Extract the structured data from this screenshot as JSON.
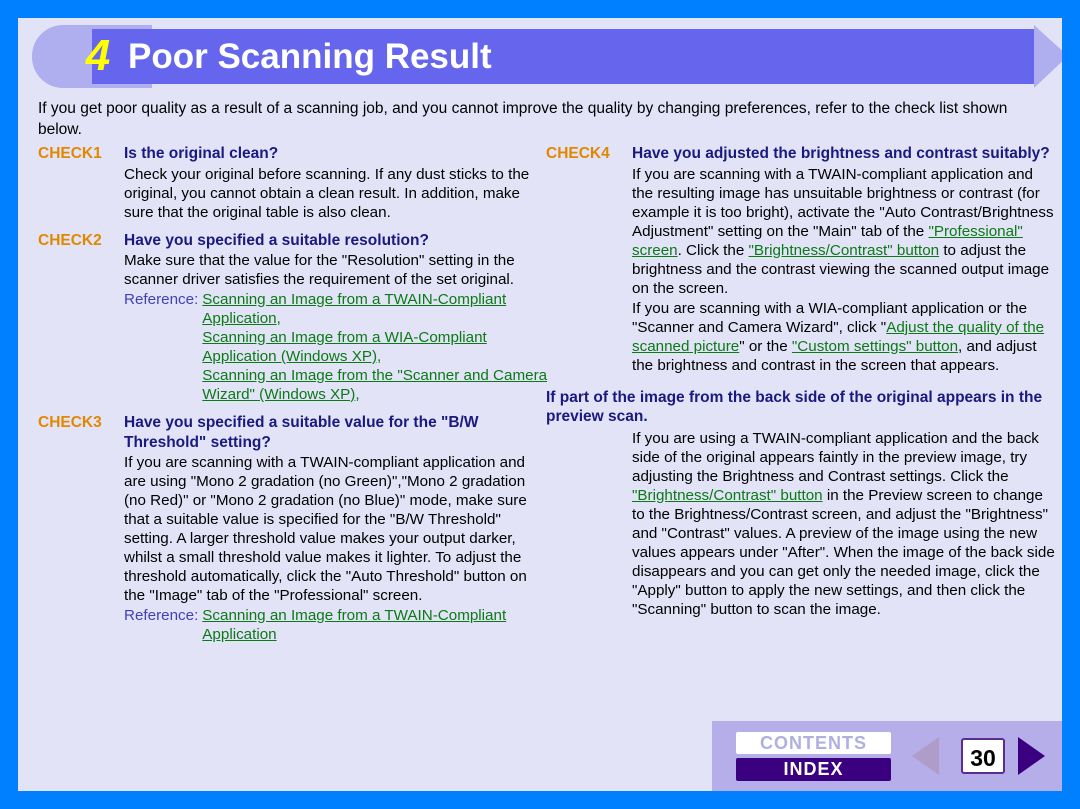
{
  "header": {
    "number": "4",
    "title": "Poor Scanning Result"
  },
  "intro": "If you get poor quality as a result of a scanning job, and you cannot improve the quality by changing preferences, refer to the check list shown below.",
  "reference_label": "Reference:",
  "checks": {
    "check1": {
      "label": "CHECK1",
      "title": "Is the original clean?",
      "body": "Check your original before scanning. If any dust sticks to the original, you cannot obtain a clean result. In addition, make sure that the original table is also clean."
    },
    "check2": {
      "label": "CHECK2",
      "title": "Have you specified a suitable resolution?",
      "body": "Make sure that the value for the \"Resolution\" setting in the scanner driver satisfies the requirement of the set original.",
      "links": [
        "Scanning an Image from a TWAIN-Compliant Application",
        "Scanning an Image from a WIA-Compliant Application (Windows XP)",
        "Scanning an Image from the \"Scanner and Camera Wizard\" (Windows XP)"
      ]
    },
    "check3": {
      "label": "CHECK3",
      "title": "Have you specified a suitable value for the \"B/W Threshold\" setting?",
      "body": "If you are scanning with a TWAIN-compliant application and are using \"Mono 2 gradation (no Green)\",\"Mono 2 gradation (no Red)\" or \"Mono 2 gradation (no Blue)\" mode, make sure that a suitable value is specified for the \"B/W Threshold\" setting. A larger threshold value makes your output darker, whilst a small threshold value makes it lighter. To adjust the threshold automatically, click the \"Auto Threshold\" button on the \"Image\" tab of the \"Professional\" screen.",
      "links": [
        "Scanning an Image from a TWAIN-Compliant Application"
      ]
    },
    "check4": {
      "label": "CHECK4",
      "title": "Have you adjusted the brightness and contrast suitably?",
      "body_p1_a": "If you are scanning with a TWAIN-compliant application and the resulting image has unsuitable brightness or contrast (for example it is too bright), activate the \"Auto Contrast/Brightness Adjustment\" setting on the \"Main\" tab of the ",
      "body_p1_link1": "\"Professional\" screen",
      "body_p1_b": ". Click the ",
      "body_p1_link2": "\"Brightness/Contrast\" button",
      "body_p1_c": " to adjust the brightness and the contrast viewing the scanned output image on the screen.",
      "body_p2_a": "If you are scanning with a WIA-compliant application or the \"Scanner and Camera Wizard\", click \"",
      "body_p2_link1": "Adjust the quality of the scanned picture",
      "body_p2_b": "\" or the ",
      "body_p2_link2": "\"Custom settings\" button",
      "body_p2_c": ", and adjust the brightness and contrast in the screen that appears."
    }
  },
  "backside_section": {
    "title": "If part of the image from the back side of the original appears in the preview scan.",
    "body_a": "If you are using a TWAIN-compliant application and the back side of the original appears faintly in the preview image, try adjusting the Brightness and Contrast settings. Click the ",
    "body_link": "\"Brightness/Contrast\" button",
    "body_b": " in the Preview screen to change to the Brightness/Contrast screen, and adjust the \"Brightness\" and \"Contrast\" values. A preview of the image using the new values appears under \"After\". When the image of the back side disappears and you can get only the needed image, click the \"Apply\" button to apply the new settings, and then click the \"Scanning\" button to scan the image."
  },
  "nav": {
    "contents_label": "CONTENTS",
    "index_label": "INDEX",
    "page_number": "30"
  },
  "colors": {
    "outer_border": "#0080FF",
    "page_background": "#E3E3F8",
    "banner_bar": "#6565EE",
    "banner_cap": "#AFAFF0",
    "banner_number": "#FFFF00",
    "check_label": "#E08900",
    "check_title": "#191980",
    "link": "#0A7A14",
    "reference_label": "#4040B8",
    "nav_background": "#B5AEE8",
    "index_button": "#3B0080",
    "arrow_prev_disabled": "#B09CC8",
    "arrow_next": "#3B0080"
  }
}
